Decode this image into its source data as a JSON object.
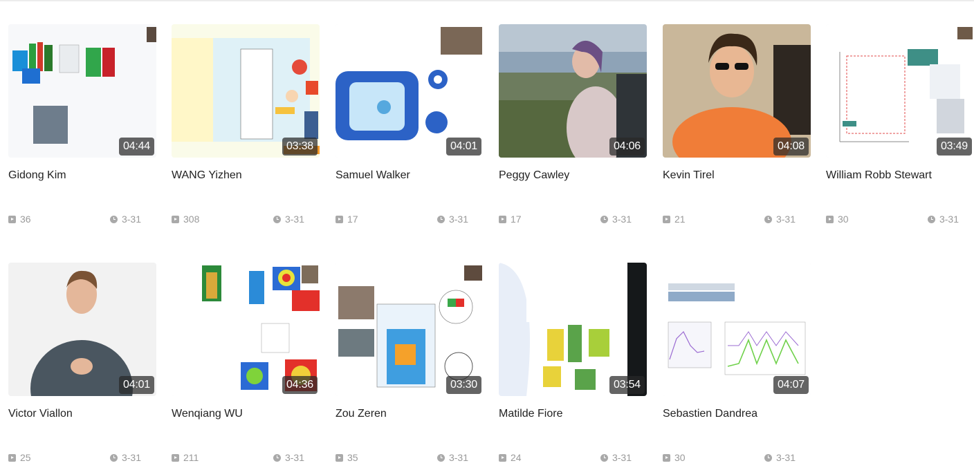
{
  "videos": [
    {
      "name": "Gidong Kim",
      "duration": "04:44",
      "plays": "36",
      "date": "3-31"
    },
    {
      "name": "WANG Yizhen",
      "duration": "03:38",
      "plays": "308",
      "date": "3-31"
    },
    {
      "name": "Samuel Walker",
      "duration": "04:01",
      "plays": "17",
      "date": "3-31"
    },
    {
      "name": "Peggy Cawley",
      "duration": "04:06",
      "plays": "17",
      "date": "3-31"
    },
    {
      "name": "Kevin Tirel",
      "duration": "04:08",
      "plays": "21",
      "date": "3-31"
    },
    {
      "name": "William Robb Stewart",
      "duration": "03:49",
      "plays": "30",
      "date": "3-31"
    },
    {
      "name": "Victor Viallon",
      "duration": "04:01",
      "plays": "25",
      "date": "3-31"
    },
    {
      "name": "Wenqiang WU",
      "duration": "04:36",
      "plays": "211",
      "date": "3-31"
    },
    {
      "name": "Zou Zeren",
      "duration": "03:30",
      "plays": "35",
      "date": "3-31"
    },
    {
      "name": "Matilde Fiore",
      "duration": "03:54",
      "plays": "24",
      "date": "3-31"
    },
    {
      "name": "Sebastien Dandrea",
      "duration": "04:07",
      "plays": "30",
      "date": "3-31"
    }
  ],
  "colors": {
    "meta_text": "#9a9a9a",
    "title_text": "#222222",
    "duration_bg": "#282828"
  },
  "icons": {
    "plays": "play-icon",
    "date": "clock-icon"
  }
}
